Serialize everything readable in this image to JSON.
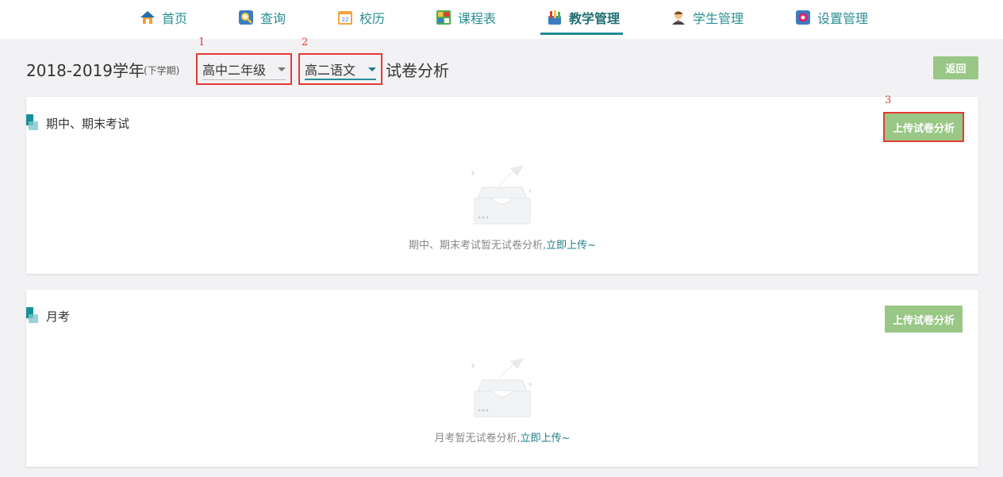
{
  "nav": {
    "items": [
      {
        "label": "首页",
        "icon": "home-icon"
      },
      {
        "label": "查询",
        "icon": "search-icon"
      },
      {
        "label": "校历",
        "icon": "calendar-icon"
      },
      {
        "label": "课程表",
        "icon": "schedule-icon"
      },
      {
        "label": "教学管理",
        "icon": "teaching-icon",
        "active": true
      },
      {
        "label": "学生管理",
        "icon": "student-icon"
      },
      {
        "label": "设置管理",
        "icon": "settings-icon"
      }
    ]
  },
  "header": {
    "year": "2018-2019学年",
    "term": "(下学期)",
    "grade_select": "高中二年级",
    "subject_select": "高二语文",
    "title": "试卷分析",
    "back_label": "返回",
    "markers": [
      "1",
      "2",
      "3"
    ]
  },
  "sections": [
    {
      "title": "期中、期末考试",
      "upload_label": "上传试卷分析",
      "empty_text": "期中、期末考试暂无试卷分析,",
      "empty_link": "立即上传~"
    },
    {
      "title": "月考",
      "upload_label": "上传试卷分析",
      "empty_text": "月考暂无试卷分析,",
      "empty_link": "立即上传~"
    }
  ],
  "colors": {
    "accent": "#1f8c93",
    "button_green": "#99c786",
    "marker_red": "#e53935"
  }
}
